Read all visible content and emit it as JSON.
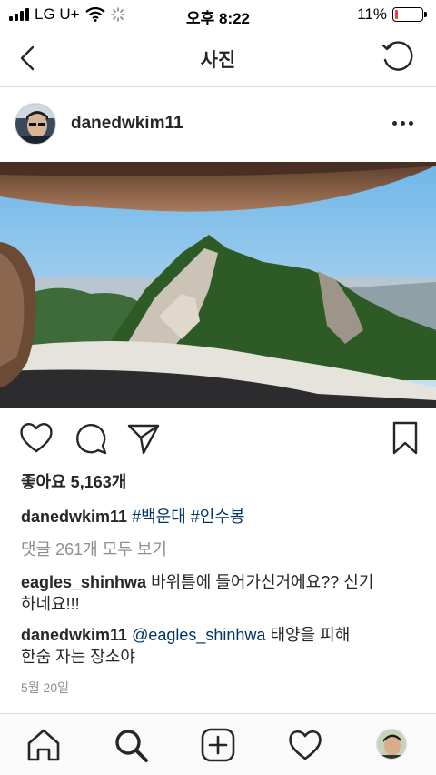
{
  "status_bar": {
    "carrier": "LG U+",
    "time": "오후 8:22",
    "battery": "11%",
    "battery_level": 0.11,
    "battery_color": "#ff3b30"
  },
  "header": {
    "title": "사진",
    "back_icon": "chevron-left-icon",
    "refresh_icon": "refresh-icon"
  },
  "post": {
    "username": "danedwkim11",
    "more_icon": "more-horizontal-icon",
    "image_description_icon": "mountain-photo",
    "likes": "좋아요 5,163개",
    "caption": {
      "username": "danedwkim11",
      "hashtags": [
        "#백운대",
        "#인수봉"
      ]
    },
    "view_comments": "댓글 261개 모두 보기",
    "comments": [
      {
        "username": "eagles_shinhwa",
        "text_line1": "바위틈에 들어가신거에요?? 신기",
        "text_line2": "하네요!!!"
      },
      {
        "username": "danedwkim11",
        "mention": "@eagles_shinhwa",
        "text_line1": "태양을 피해",
        "text_line2": "한숨 자는 장소야"
      }
    ],
    "date": "5월 20일"
  },
  "actions": [
    "heart-icon",
    "comment-icon",
    "send-icon",
    "bookmark-icon"
  ],
  "tabbar": [
    "home-icon",
    "search-icon",
    "add-icon",
    "activity-icon",
    "profile-avatar"
  ],
  "colors": {
    "hashtag": "#003569",
    "muted": "#8e8e8e",
    "text": "#262626",
    "border": "#dbdbdb"
  }
}
